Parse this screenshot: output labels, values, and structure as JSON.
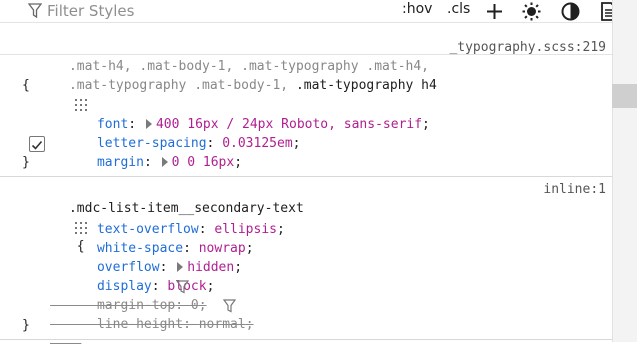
{
  "toolbar": {
    "filter_placeholder": "Filter Styles",
    "hov_label": ":hov",
    "cls_label": ".cls",
    "icons": [
      "filter-icon",
      "add-icon",
      "sun-icon",
      "contrast-icon",
      "document-icon"
    ]
  },
  "rules": [
    {
      "selector_line1": ".mat-h4, .mat-body-1, .mat-typography .mat-h4,",
      "selector_line2_dim": ".mat-typography .mat-body-1, ",
      "selector_line2_strong": ".mat-typography h4",
      "source": "_typography.scss:219",
      "declarations": [
        {
          "name": "font",
          "value": "400 16px / 24px Roboto, sans-serif"
        },
        {
          "name": "letter-spacing",
          "value": "0.03125em"
        },
        {
          "name": "margin",
          "value": "0 0 16px"
        }
      ]
    },
    {
      "selector": ".mdc-list-item__secondary-text",
      "source": "inline:1",
      "declarations": [
        {
          "name": "text-overflow",
          "value": "ellipsis"
        },
        {
          "name": "white-space",
          "value": "nowrap"
        },
        {
          "name": "overflow",
          "value": "hidden"
        },
        {
          "name": "display",
          "value": "block"
        },
        {
          "name": "margin-top",
          "value": "0"
        },
        {
          "name": "line-height",
          "value": "normal"
        }
      ]
    }
  ],
  "brace_open": "{",
  "brace_close": "}"
}
